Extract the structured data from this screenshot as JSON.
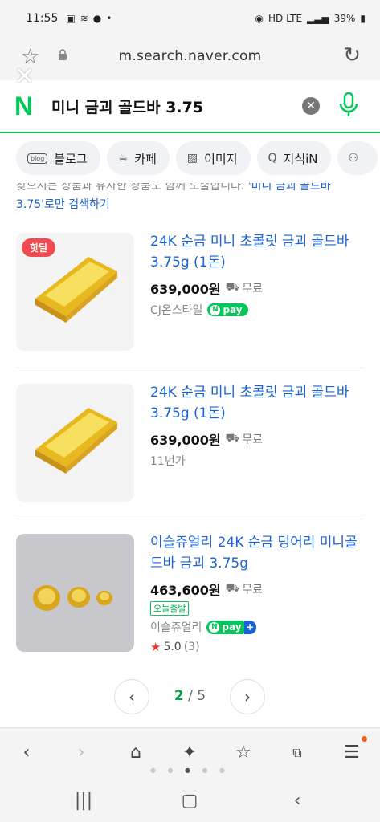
{
  "status": {
    "time": "11:55",
    "network": "HD LTE",
    "battery": "39%"
  },
  "browser": {
    "url": "m.search.naver.com"
  },
  "search": {
    "logo": "N",
    "query": "미니 금괴 골드바 3.75"
  },
  "tabs": [
    {
      "label": "블로그",
      "icon": "blog-icon",
      "badge": "blog"
    },
    {
      "label": "카페",
      "icon": "cafe-icon"
    },
    {
      "label": "이미지",
      "icon": "image-icon"
    },
    {
      "label": "지식iN",
      "icon": "knowledge-search-icon"
    },
    {
      "label": "",
      "icon": "person-icon"
    }
  ],
  "notice": {
    "text": "찾으시는 상품과 유사한 상품도 함께 노출합니다.",
    "link": "'미니 금괴 골드바 3.75'로만 검색하기"
  },
  "products": [
    {
      "badge": "핫딜",
      "title": "24K 순금 미니 초콜릿 금괴 골드바 3.75g (1돈)",
      "price": "639,000원",
      "shipping": "무료",
      "seller": "CJ온스타일",
      "pay": "pay"
    },
    {
      "title": "24K 순금 미니 초콜릿 금괴 골드바 3.75g (1돈)",
      "price": "639,000원",
      "shipping": "무료",
      "seller": "11번가"
    },
    {
      "title": "이슬쥬얼리 24K 순금 덩어리 미니골드바 금괴 3.75g",
      "price": "463,600원",
      "shipping": "무료",
      "tag": "오늘출발",
      "seller": "이슬쥬얼리",
      "pay": "pay",
      "rating": "5.0",
      "reviews": "(3)"
    }
  ],
  "pager": {
    "current": "2",
    "separator": "/",
    "total": "5"
  },
  "colors": {
    "naver_green": "#03c75a",
    "link_blue": "#1a62d6",
    "hotdeal_red": "#f04b52"
  }
}
